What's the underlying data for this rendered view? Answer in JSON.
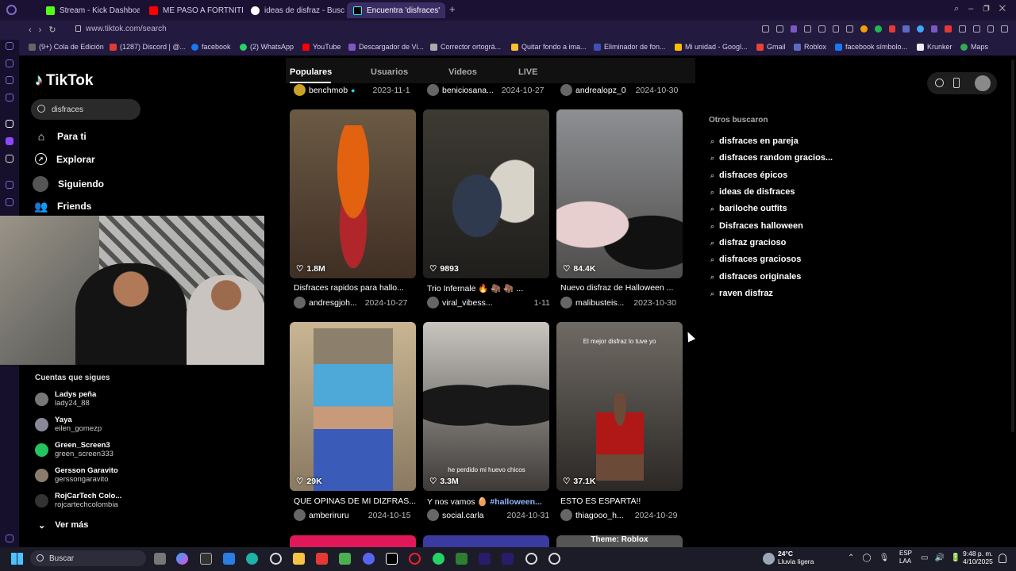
{
  "browser": {
    "tabs": [
      {
        "label": "Stream - Kick Dashboard",
        "color": "#53fc18"
      },
      {
        "label": "ME PASO A FORTNITE - Y",
        "color": "#ff0000"
      },
      {
        "label": "ideas de disfraz - Buscar",
        "color": "#ffffff"
      },
      {
        "label": "Encuentra 'disfraces'",
        "color": "#000000"
      }
    ],
    "url": "www.tiktok.com/search",
    "bookmarks": [
      {
        "label": "(9+) Cola de Edición",
        "color": "#666"
      },
      {
        "label": "(1287) Discord | @...",
        "color": "#e53935"
      },
      {
        "label": "facebook",
        "color": "#1877f2"
      },
      {
        "label": "(2) WhatsApp",
        "color": "#25d366"
      },
      {
        "label": "YouTube",
        "color": "#ff0000"
      },
      {
        "label": "Descargador de Vi...",
        "color": "#7e57c2"
      },
      {
        "label": "Corrector ortográ...",
        "color": "#aaa"
      },
      {
        "label": "Quitar fondo a ima...",
        "color": "#fbc02d"
      },
      {
        "label": "Eliminador de fon...",
        "color": "#3f51b5"
      },
      {
        "label": "Mi unidad - Googl...",
        "color": "#fbbc04"
      },
      {
        "label": "Gmail",
        "color": "#ea4335"
      },
      {
        "label": "Roblox",
        "color": "#5c6bc0"
      },
      {
        "label": "facebook símbolo...",
        "color": "#1877f2"
      },
      {
        "label": "Krunker",
        "color": "#eee"
      },
      {
        "label": "Maps",
        "color": "#34a853"
      }
    ]
  },
  "sidebar": {
    "logo": "TikTok",
    "search_value": "disfraces",
    "nav": [
      {
        "label": "Para ti",
        "icon": "home-icon"
      },
      {
        "label": "Explorar",
        "icon": "compass-icon"
      },
      {
        "label": "Siguiendo",
        "icon": "following-icon"
      },
      {
        "label": "Friends",
        "icon": "friends-icon"
      }
    ],
    "following_header": "Cuentas que sigues",
    "accounts": [
      {
        "name": "Ladys peña",
        "user": "lady24_88"
      },
      {
        "name": "Yaya",
        "user": "eilen_gomezp"
      },
      {
        "name": "Green_Screen3",
        "user": "green_screen333"
      },
      {
        "name": "Gersson Garavito",
        "user": "gerssongaravito"
      },
      {
        "name": "RojCarTech Colo...",
        "user": "rojcartechcolombia"
      }
    ],
    "more": "Ver más"
  },
  "search_tabs": [
    "Populares",
    "Usuarios",
    "Videos",
    "LIVE"
  ],
  "top_row": [
    {
      "user": "benchmob",
      "date": "2023-11-1"
    },
    {
      "user": "beniciosana...",
      "date": "2024-10-27"
    },
    {
      "user": "andrealopz_0",
      "date": "2024-10-30"
    }
  ],
  "videos": [
    {
      "likes": "1.8M",
      "caption": "Disfraces rapidos para hallo...",
      "user": "andresgjoh...",
      "date": "2024-10-27",
      "bg": "linear-gradient(180deg,#6b5a44,#3f2f24)"
    },
    {
      "likes": "9893",
      "caption": "Trio Infernale 🔥 🦣 🦣 ...",
      "user": "viral_vibess...",
      "date": "1-11",
      "bg": "linear-gradient(180deg,#3d3a33,#1f1e1c)"
    },
    {
      "likes": "84.4K",
      "caption": "Nuevo disfraz de Halloween ...",
      "user": "malibusteis...",
      "date": "2023-10-30",
      "bg": "linear-gradient(180deg,#8d8f92,#4f4d4c)"
    },
    {
      "likes": "29K",
      "caption": "QUE OPINAS DE MI DIZFRAS...",
      "user": "amberiruru",
      "date": "2024-10-15",
      "bg": "linear-gradient(180deg,#c9b592,#5a6fa8)"
    },
    {
      "likes": "3.3M",
      "caption": "Y nos vamos 🥚 ",
      "hashtag": "#halloween...",
      "user": "social.carla",
      "date": "2024-10-31",
      "overlay": "he perdido mi huevo chicos",
      "bg": "linear-gradient(180deg,#c8c4be,#3d3a38)"
    },
    {
      "likes": "37.1K",
      "caption": "ESTO ES ESPARTA!!",
      "user": "thiagooo_h...",
      "date": "2024-10-29",
      "overlay": "El mejor disfraz lo tuve yo",
      "bg": "linear-gradient(180deg,#6f6a63,#2b2826)"
    }
  ],
  "bottom_peek_label": "Theme: Roblox",
  "right": {
    "header": "Otros buscaron",
    "suggestions": [
      "disfraces en pareja",
      "disfraces random gracios...",
      "disfraces épicos",
      "ideas de disfraces",
      "bariloche outfits",
      "Disfraces halloween",
      "disfraz gracioso",
      "disfraces graciosos",
      "disfraces originales",
      "raven disfraz"
    ]
  },
  "taskbar": {
    "search": "Buscar",
    "weather_temp": "24°C",
    "weather_desc": "Lluvia ligera",
    "lang1": "ESP",
    "lang2": "LAA",
    "time": "9:48 p. m.",
    "date": "4/10/2025"
  }
}
